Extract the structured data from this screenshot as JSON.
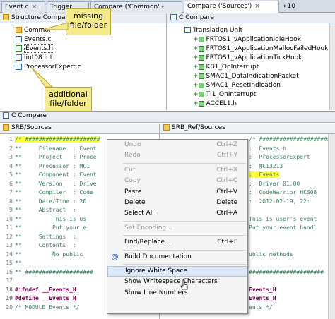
{
  "tabs": [
    {
      "label": "Event.c"
    },
    {
      "label": "Trigger"
    },
    {
      "label": "Compare ('Common' -"
    },
    {
      "label": "Compare ('Sources')"
    },
    {
      "label": "10"
    }
  ],
  "left_pane": {
    "title": "Structure Compare",
    "items": [
      {
        "label": "Common",
        "type": "folder"
      },
      {
        "label": "Events.c",
        "type": "c"
      },
      {
        "label": "Events.h",
        "type": "h"
      },
      {
        "label": "lint08.lnt",
        "type": "plus-file"
      },
      {
        "label": "ProcessorExpert.c",
        "type": "c"
      }
    ]
  },
  "right_pane": {
    "title": "C Compare",
    "root": "Translation Unit",
    "items": [
      "FRTOS1_vApplicationIdleHook",
      "FRTOS1_vApplicationMallocFailedHook",
      "FRTOS1_vApplicationTickHook",
      "KB1_OnInterrupt",
      "SMAC1_DataIndicationPacket",
      "SMAC1_ResetIndication",
      "TI1_OnInterrupt",
      "ACCEL1.h"
    ]
  },
  "callouts": {
    "missing": "missing\nfile/folder",
    "additional": "additional\nfile/folder"
  },
  "bottom_title": "C Compare",
  "left_code": {
    "title": "SRB/Sources",
    "lines": [
      {
        "n": "1",
        "t": "/* ######################"
      },
      {
        "n": "2",
        "t": "**     Filename  : Event"
      },
      {
        "n": "3",
        "t": "**     Project   : Proce"
      },
      {
        "n": "4",
        "t": "**     Processor : MC1"
      },
      {
        "n": "5",
        "t": "**     Component : Event"
      },
      {
        "n": "6",
        "t": "**     Version   : Drive"
      },
      {
        "n": "7",
        "t": "**     Compiler  : Code"
      },
      {
        "n": "8",
        "t": "**     Date/Time : 20"
      },
      {
        "n": "9",
        "t": "**     Abstract  :"
      },
      {
        "n": "10",
        "t": "**         This is us"
      },
      {
        "n": "11",
        "t": "**         Put your e"
      },
      {
        "n": "12",
        "t": "**     Settings  :"
      },
      {
        "n": "13",
        "t": "**     Contents  :"
      },
      {
        "n": "14",
        "t": "**         No public"
      },
      {
        "n": "15",
        "t": "**"
      },
      {
        "n": "16",
        "t": "** ####################"
      },
      {
        "n": "17",
        "t": ""
      },
      {
        "n": "18",
        "t": "#ifndef __Events_H"
      },
      {
        "n": "19",
        "t": "#define __Events_H"
      },
      {
        "n": "20",
        "t": "/* MODULE Events */"
      }
    ]
  },
  "right_code": {
    "title": "SRB_Ref/Sources",
    "lines": [
      "/* ######################",
      ":  Events.h",
      ":  ProcessorExpert",
      ":  MC13213",
      ":  Events",
      ":  Driver 01.00",
      ":  CodeWarrior HCS08",
      ":  2012-02-19, 22:",
      "",
      "This is user's event",
      "Put your event handl",
      "",
      "",
      "ublic methods",
      "",
      "######################",
      "",
      "Events_H",
      "Events_H",
      "ents */"
    ]
  },
  "context_menu": {
    "items": [
      {
        "label": "Undo",
        "shortcut": "Ctrl+Z",
        "disabled": true
      },
      {
        "label": "Redo",
        "shortcut": "Ctrl+Y",
        "disabled": true
      },
      {
        "sep": true
      },
      {
        "label": "Cut",
        "shortcut": "Ctrl+X",
        "disabled": true
      },
      {
        "label": "Copy",
        "shortcut": "Ctrl+C",
        "disabled": true
      },
      {
        "label": "Paste",
        "shortcut": "Ctrl+V",
        "disabled": false
      },
      {
        "label": "Delete",
        "shortcut": "Delete",
        "disabled": false
      },
      {
        "label": "Select All",
        "shortcut": "Ctrl+A",
        "disabled": false
      },
      {
        "sep": true
      },
      {
        "label": "Set Encoding...",
        "shortcut": "",
        "disabled": true
      },
      {
        "sep": true
      },
      {
        "label": "Find/Replace...",
        "shortcut": "Ctrl+F",
        "disabled": false
      },
      {
        "sep": true
      },
      {
        "label": "Build Documentation",
        "shortcut": "",
        "disabled": false,
        "icon": "@"
      },
      {
        "sep": true
      },
      {
        "label": "Ignore White Space",
        "shortcut": "",
        "disabled": false,
        "hover": true
      },
      {
        "label": "Show Whitespace Characters",
        "shortcut": "",
        "disabled": false
      },
      {
        "label": "Show Line Numbers",
        "shortcut": "",
        "disabled": false
      }
    ]
  },
  "colors": {
    "highlight": "#ffff33",
    "callout": "#f5eb8a",
    "tab_active": "#ffffff"
  }
}
